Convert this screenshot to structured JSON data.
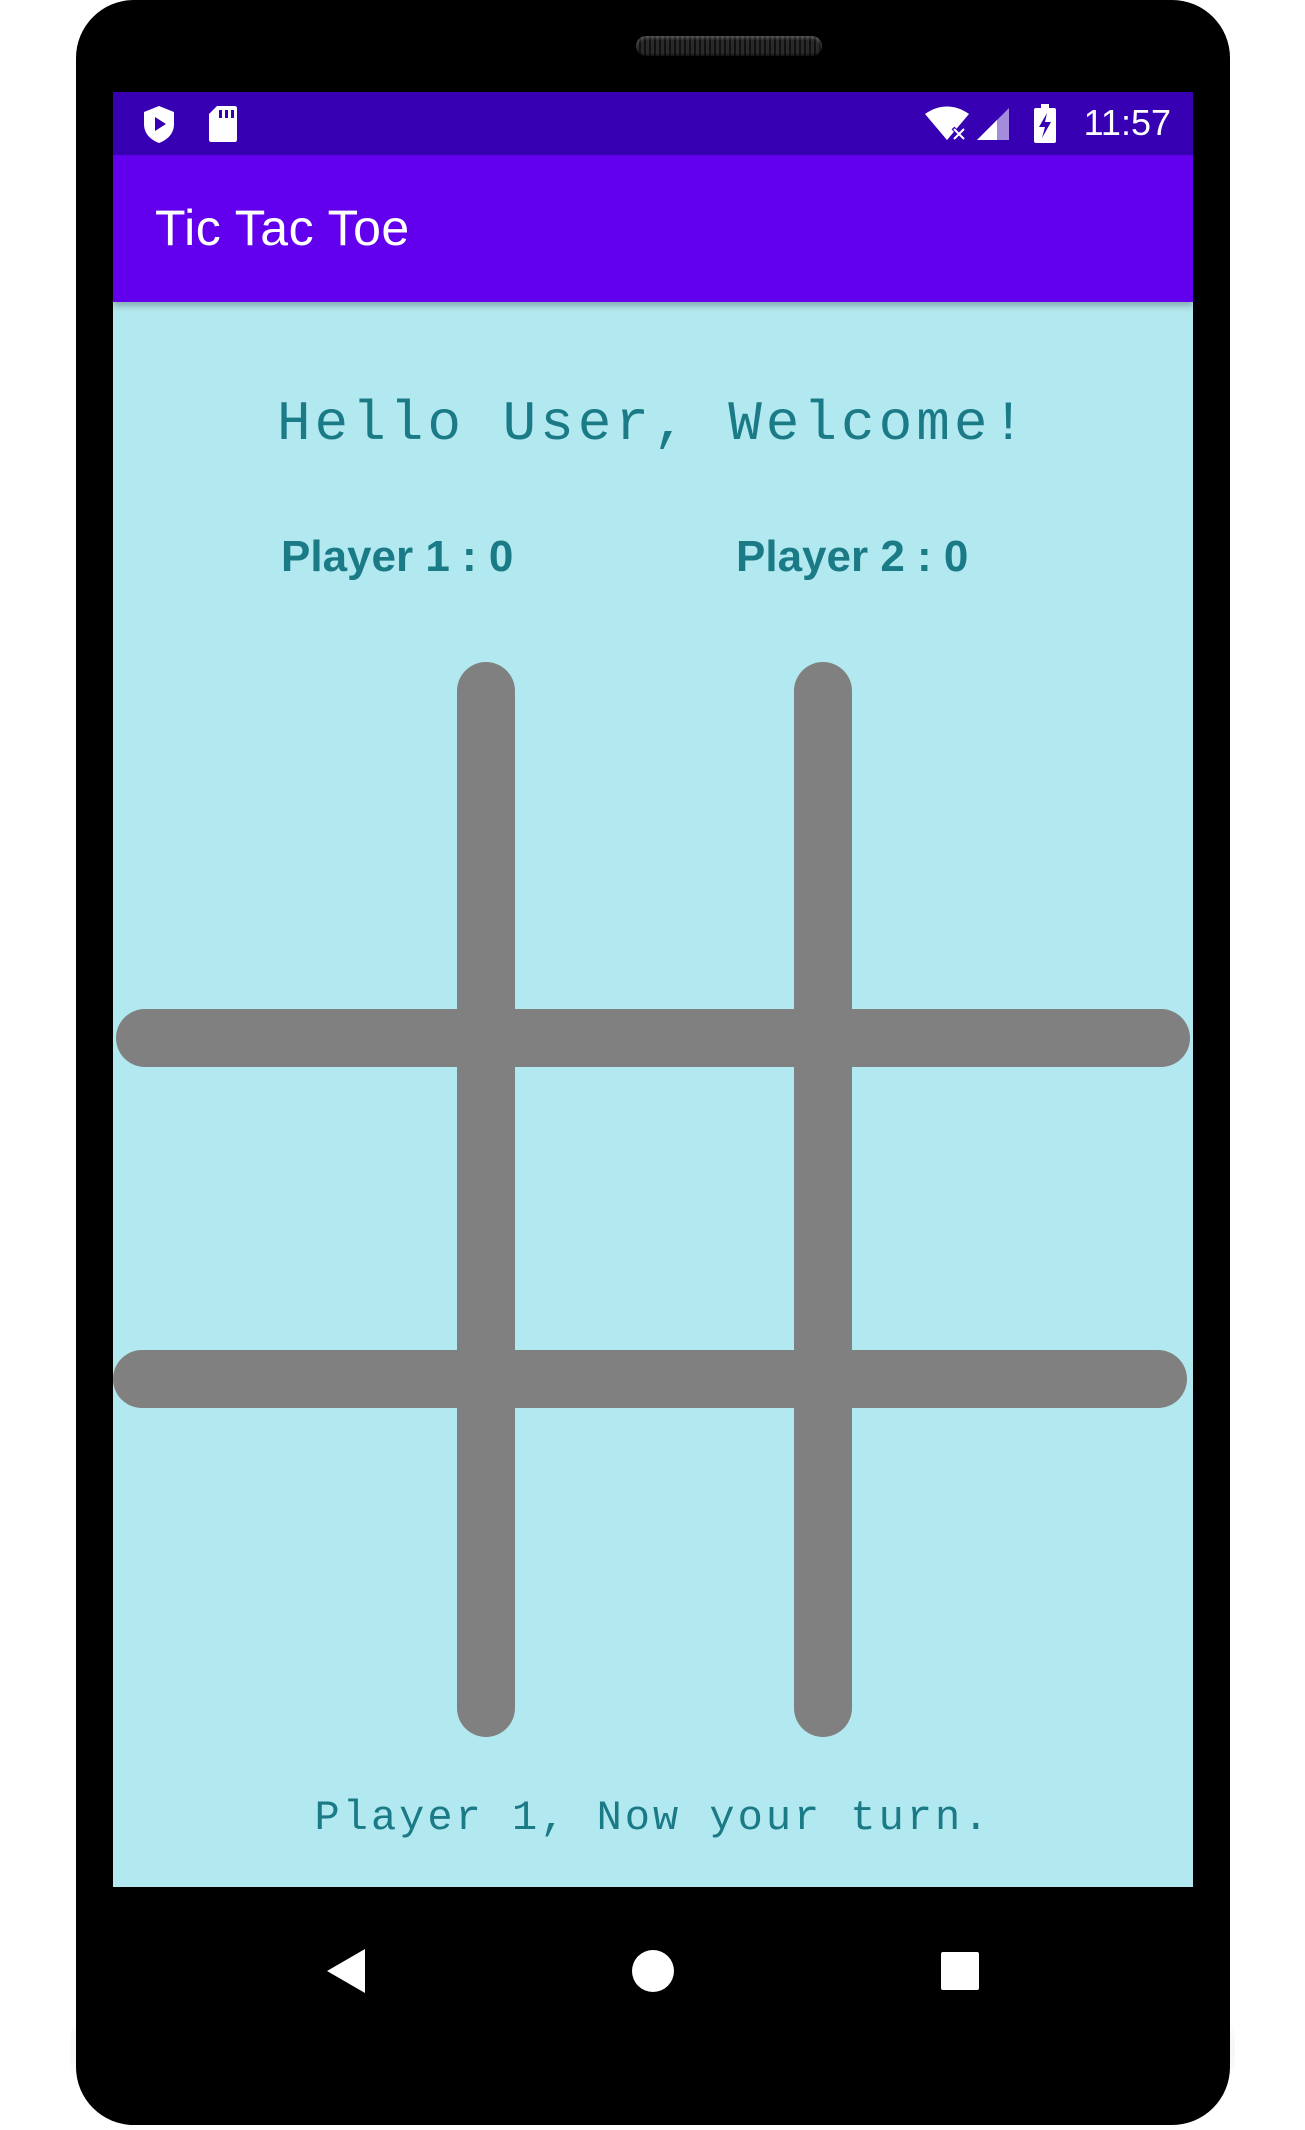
{
  "status_bar": {
    "time": "11:57",
    "icons": [
      "shield-play-icon",
      "sd-card-icon",
      "wifi-icon",
      "signal-icon",
      "battery-charging-icon"
    ]
  },
  "app_bar": {
    "title": "Tic Tac Toe"
  },
  "game": {
    "welcome": "Hello User, Welcome!",
    "score_player1": "Player 1 : 0",
    "score_player2": "Player 2 : 0",
    "turn_message": "Player 1, Now your turn.",
    "board": [
      "",
      "",
      "",
      "",
      "",
      "",
      "",
      "",
      ""
    ]
  },
  "nav_bar": {
    "icons": [
      "back-icon",
      "home-icon",
      "recents-icon"
    ]
  },
  "colors": {
    "status_bar": "#3700b3",
    "app_bar": "#6200ee",
    "background": "#b2e8ef",
    "text": "#1a7a86",
    "grid": "#808080"
  }
}
